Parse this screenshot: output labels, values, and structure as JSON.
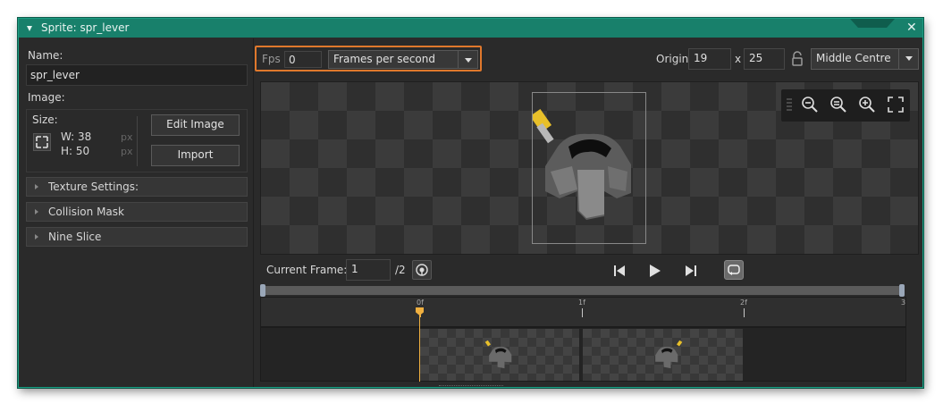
{
  "window": {
    "title": "Sprite: spr_lever",
    "close_glyph": "✕"
  },
  "left": {
    "name_label": "Name:",
    "name_value": "spr_lever",
    "image_label": "Image:",
    "size_label": "Size:",
    "width": "W: 38",
    "height": "H: 50",
    "px_w": "px",
    "px_h": "px",
    "edit_image": "Edit Image",
    "import": "Import",
    "sections": [
      "Texture Settings:",
      "Collision Mask",
      "Nine Slice"
    ]
  },
  "topbar": {
    "fps_label": "Fps",
    "fps_value": "0",
    "fps_mode": "Frames per second",
    "origin_label": "Origin",
    "origin_x": "19",
    "x_sep": "x",
    "origin_y": "25",
    "origin_preset": "Middle Centre"
  },
  "playback": {
    "current_frame_label": "Current Frame:",
    "current_frame": "1",
    "frame_total": "/2"
  },
  "timeline": {
    "ticks": [
      "0f",
      "1f",
      "2f",
      "3"
    ]
  },
  "colors": {
    "accent": "#18806b",
    "highlight": "#e0782c",
    "playhead": "#f0b040"
  },
  "icons": [
    "expand-icon",
    "lock-icon",
    "zoom-out-icon",
    "zoom-reset-icon",
    "zoom-in-icon",
    "fullscreen-icon",
    "ping-icon",
    "skip-start-icon",
    "play-icon",
    "skip-end-icon",
    "loop-icon"
  ]
}
